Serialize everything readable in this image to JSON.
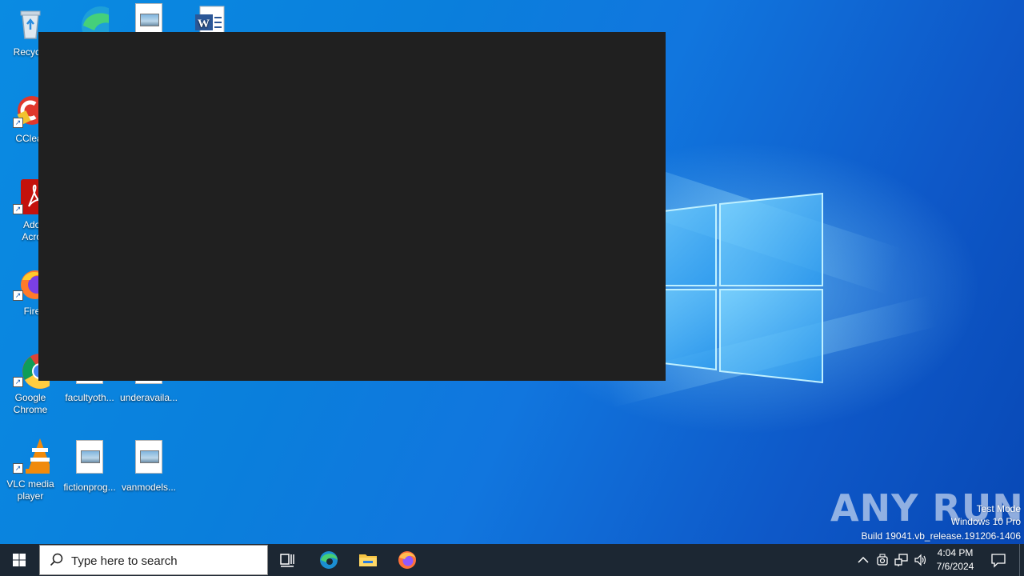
{
  "desktop": {
    "icons": [
      {
        "label": "Recycle",
        "name": "recycle-bin-icon"
      },
      {
        "label": "CClear",
        "name": "ccleaner-icon"
      },
      {
        "label": "Adob Acrob",
        "name": "adobe-acrobat-icon"
      },
      {
        "label": "Firefo",
        "name": "firefox-desktop-icon"
      },
      {
        "label": "Google Chrome",
        "name": "google-chrome-icon"
      },
      {
        "label": "VLC media player",
        "name": "vlc-icon"
      },
      {
        "label": "facultyoth...",
        "name": "image-file-icon"
      },
      {
        "label": "underavaila...",
        "name": "image-file-icon"
      },
      {
        "label": "fictionprog...",
        "name": "image-file-icon"
      },
      {
        "label": "vanmodels...",
        "name": "image-file-icon"
      }
    ]
  },
  "watermark": {
    "logo": "ANY RUN",
    "mode": "Test Mode",
    "edition": "Windows 10 Pro",
    "build": "Build 19041.vb_release.191206-1406"
  },
  "taskbar": {
    "search_placeholder": "Type here to search",
    "time": "4:04 PM",
    "date": "7/6/2024"
  }
}
